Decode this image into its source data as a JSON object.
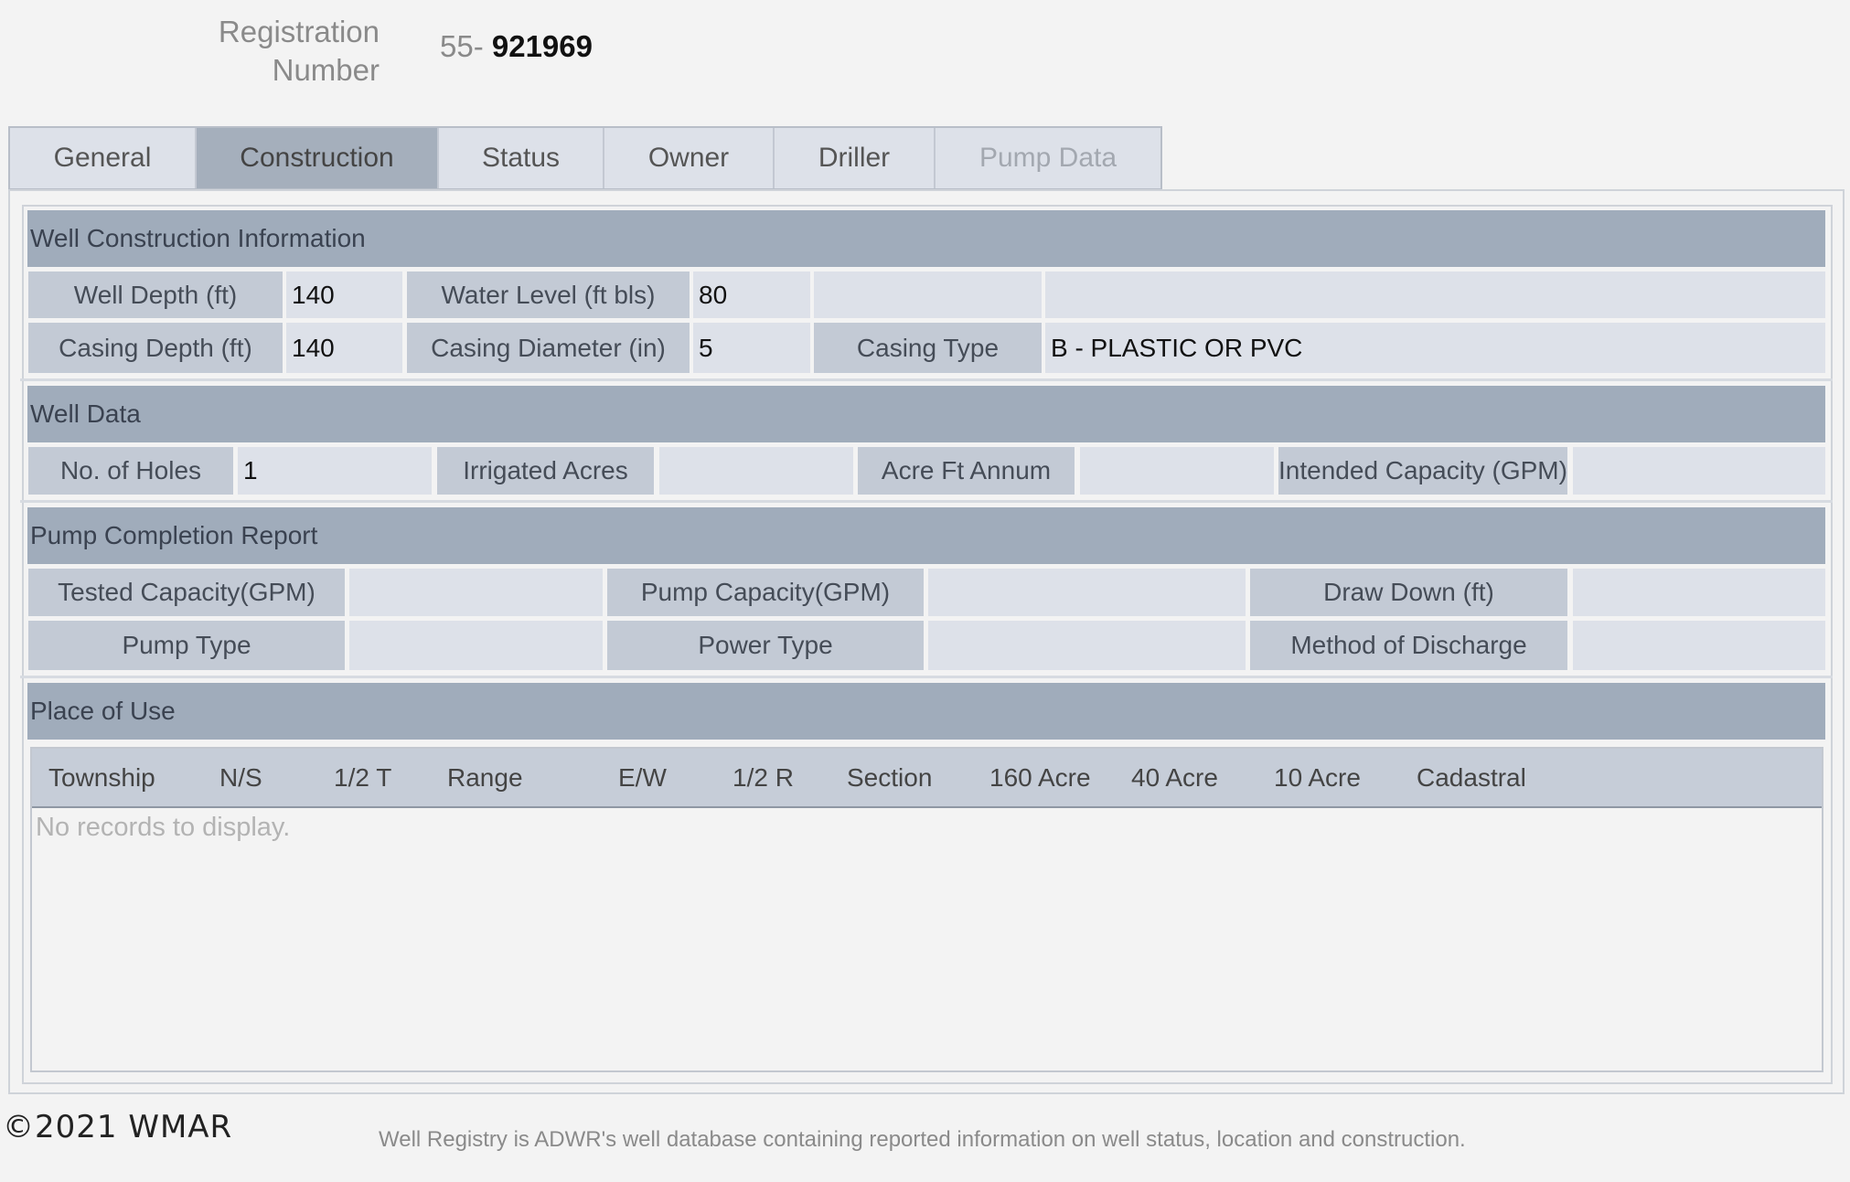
{
  "header": {
    "label_line1": "Registration",
    "label_line2": "Number",
    "prefix": "55-",
    "number": "921969"
  },
  "tabs": [
    {
      "label": "General",
      "state": "normal"
    },
    {
      "label": "Construction",
      "state": "active"
    },
    {
      "label": "Status",
      "state": "normal"
    },
    {
      "label": "Owner",
      "state": "normal"
    },
    {
      "label": "Driller",
      "state": "normal"
    },
    {
      "label": "Pump Data",
      "state": "disabled"
    }
  ],
  "construction": {
    "title": "Well Construction Information",
    "well_depth_label": "Well Depth (ft)",
    "well_depth": "140",
    "water_level_label": "Water Level (ft bls)",
    "water_level": "80",
    "casing_depth_label": "Casing Depth (ft)",
    "casing_depth": "140",
    "casing_diameter_label": "Casing Diameter (in)",
    "casing_diameter": "5",
    "casing_type_label": "Casing Type",
    "casing_type": "B - PLASTIC OR PVC"
  },
  "well_data": {
    "title": "Well Data",
    "holes_label": "No. of Holes",
    "holes": "1",
    "irrigated_label": "Irrigated Acres",
    "irrigated": "",
    "acre_ft_label": "Acre Ft Annum",
    "acre_ft": "",
    "intended_label": "Intended Capacity (GPM)",
    "intended": ""
  },
  "pump": {
    "title": "Pump Completion Report",
    "tested_label": "Tested Capacity(GPM)",
    "tested": "",
    "pump_capacity_label": "Pump Capacity(GPM)",
    "pump_capacity": "",
    "draw_down_label": "Draw Down (ft)",
    "draw_down": "",
    "pump_type_label": "Pump Type",
    "pump_type": "",
    "power_type_label": "Power Type",
    "power_type": "",
    "discharge_label": "Method of Discharge",
    "discharge": ""
  },
  "place_of_use": {
    "title": "Place of Use",
    "columns": [
      "Township",
      "N/S",
      "1/2 T",
      "Range",
      "E/W",
      "1/2 R",
      "Section",
      "160 Acre",
      "40 Acre",
      "10 Acre",
      "Cadastral"
    ],
    "empty_text": "No records to display."
  },
  "footer": {
    "copyright": "©2021 WMAR",
    "note": "Well Registry is ADWR's well database containing reported information on well status, location and construction."
  },
  "colors": {
    "section_header": "#a0acbb",
    "label_cell": "#c3cad5",
    "value_cell": "#dde1e9",
    "active_tab": "#a5afbc"
  }
}
